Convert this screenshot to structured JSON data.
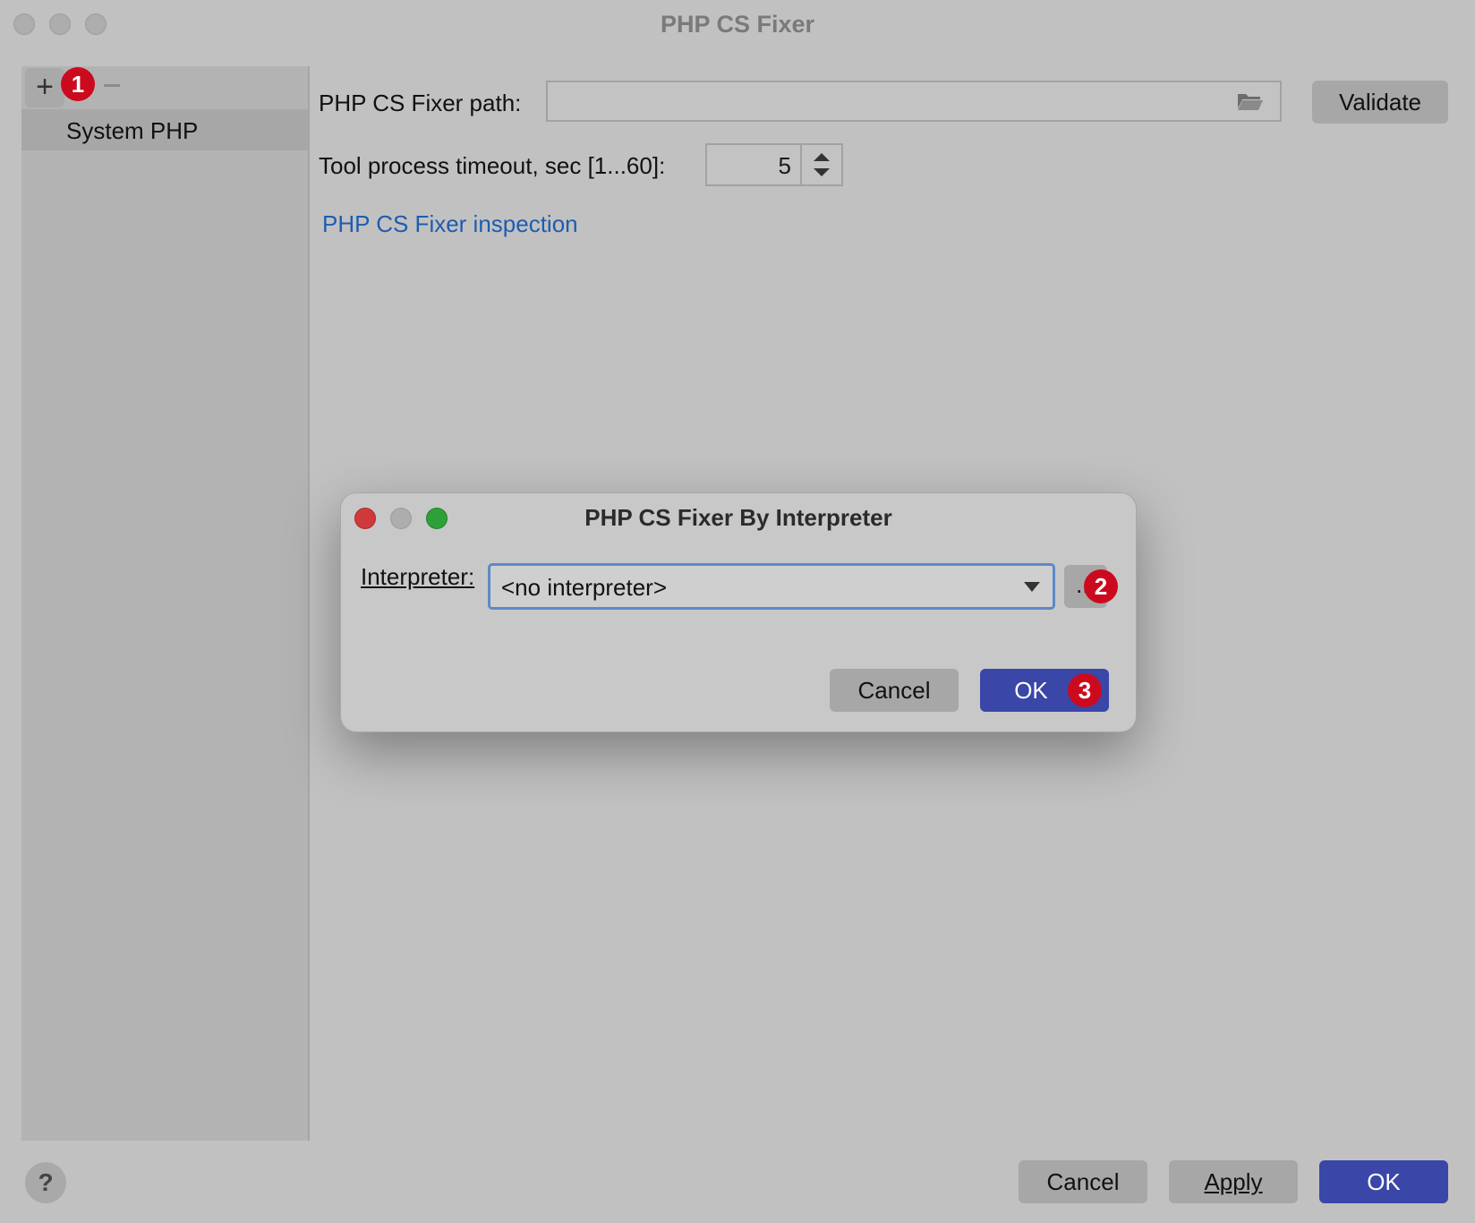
{
  "window": {
    "title": "PHP CS Fixer"
  },
  "sidebar": {
    "items": [
      {
        "label": "System PHP"
      }
    ]
  },
  "form": {
    "path_label": "PHP CS Fixer path:",
    "path_value": "",
    "validate_label": "Validate",
    "timeout_label": "Tool process timeout, sec [1...60]:",
    "timeout_value": "5",
    "inspection_link": "PHP CS Fixer inspection"
  },
  "dialog": {
    "title": "PHP CS Fixer By Interpreter",
    "interpreter_label": "Interpreter:",
    "interpreter_value": "<no interpreter>",
    "browse_label": "...",
    "cancel_label": "Cancel",
    "ok_label": "OK"
  },
  "footer": {
    "help_label": "?",
    "cancel_label": "Cancel",
    "apply_label": "Apply",
    "ok_label": "OK"
  },
  "badges": [
    "1",
    "2",
    "3"
  ],
  "colors": {
    "primary_button": "#3a47a8",
    "link": "#1e5cae",
    "badge": "#cc0a1d",
    "close_light": "#d0393b",
    "zoom_light": "#2ea039"
  }
}
